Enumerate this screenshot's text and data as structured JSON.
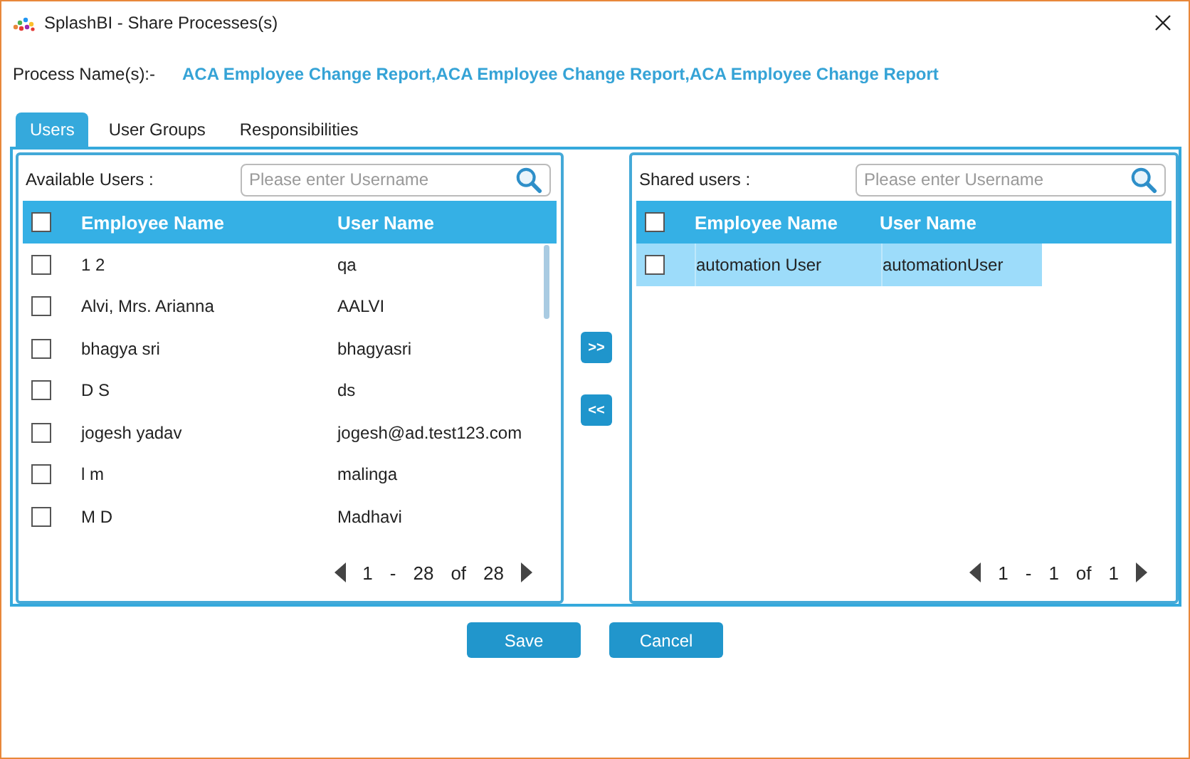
{
  "window": {
    "title": "SplashBI - Share Processes(s)"
  },
  "process": {
    "label": "Process Name(s):-",
    "value": "ACA Employee Change Report,ACA Employee Change Report,ACA Employee Change Report"
  },
  "tabs": [
    {
      "label": "Users",
      "selected": true
    },
    {
      "label": "User Groups",
      "selected": false
    },
    {
      "label": "Responsibilities",
      "selected": false
    }
  ],
  "available": {
    "label": "Available Users :",
    "search": {
      "placeholder": "Please enter Username"
    },
    "header_checked": false,
    "columns": [
      "Employee Name",
      "User Name"
    ],
    "rows": [
      {
        "employee": "1 2",
        "user": "qa",
        "checked": false,
        "selected": false
      },
      {
        "employee": "Alvi, Mrs. Arianna",
        "user": "AALVI",
        "checked": false,
        "selected": false
      },
      {
        "employee": "bhagya sri",
        "user": "bhagyasri",
        "checked": false,
        "selected": false
      },
      {
        "employee": "D S",
        "user": "ds",
        "checked": false,
        "selected": false
      },
      {
        "employee": "jogesh yadav",
        "user": "jogesh@ad.test123.com",
        "checked": false,
        "selected": false
      },
      {
        "employee": "l m",
        "user": "malinga",
        "checked": false,
        "selected": false
      },
      {
        "employee": "M D",
        "user": "Madhavi",
        "checked": false,
        "selected": false
      }
    ],
    "pager": {
      "from": "1",
      "dash": "-",
      "to": "28",
      "of": "of",
      "total": "28"
    }
  },
  "move_buttons": [
    ">>",
    "<<"
  ],
  "shared": {
    "label": "Shared users :",
    "search": {
      "placeholder": "Please enter Username"
    },
    "header_checked": false,
    "columns": [
      "Employee Name",
      "User Name"
    ],
    "rows": [
      {
        "employee": "automation User",
        "user": "automationUser",
        "checked": false,
        "selected": true
      }
    ],
    "pager": {
      "from": "1",
      "dash": "-",
      "to": "1",
      "of": "of",
      "total": "1"
    }
  },
  "buttons": [
    "Save",
    "Cancel"
  ]
}
